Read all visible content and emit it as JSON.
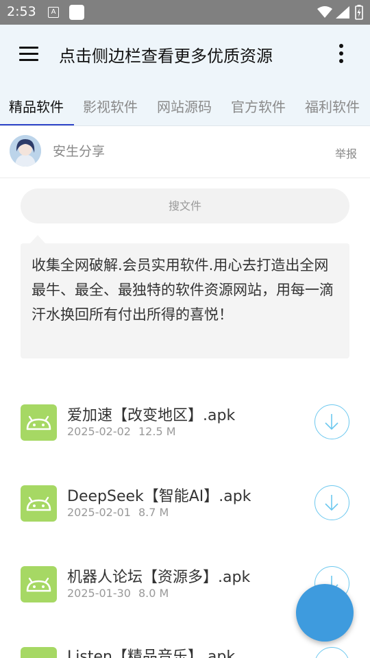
{
  "status_bar": {
    "time": "2:53",
    "notification_badge": "A",
    "icons": [
      "a-notification-icon",
      "square-notification-icon",
      "wifi-icon",
      "signal-icon",
      "battery-icon"
    ]
  },
  "app_bar": {
    "title": "点击侧边栏查看更多优质资源",
    "background": "#eef5fa"
  },
  "tabs": [
    {
      "label": "精品软件",
      "active": true
    },
    {
      "label": "影视软件",
      "active": false
    },
    {
      "label": "网站源码",
      "active": false
    },
    {
      "label": "官方软件",
      "active": false
    },
    {
      "label": "福利软件",
      "active": false
    }
  ],
  "poster": {
    "name": "安生分享",
    "report_label": "举报"
  },
  "search": {
    "placeholder": "搜文件"
  },
  "description": "收集全网破解.会员实用软件.用心去打造出全网最牛、最全、最独特的软件资源网站，用每一滴汗水换回所有付出所得的喜悦！",
  "files": [
    {
      "name": "爱加速【改变地区】.apk",
      "date": "2025-02-02",
      "size": "12.5 M",
      "icon": "android-icon"
    },
    {
      "name": "DeepSeek【智能AI】.apk",
      "date": "2025-02-01",
      "size": "8.7 M",
      "icon": "android-icon"
    },
    {
      "name": "机器人论坛【资源多】.apk",
      "date": "2025-01-30",
      "size": "8.0 M",
      "icon": "android-icon"
    },
    {
      "name": "Listen【精品音乐】.apk",
      "date": "",
      "size": "",
      "icon": "android-icon"
    }
  ],
  "colors": {
    "accent": "#2f44c9",
    "download": "#6cc8ef",
    "fab": "#3e9bde",
    "android_icon": "#a6d864"
  }
}
